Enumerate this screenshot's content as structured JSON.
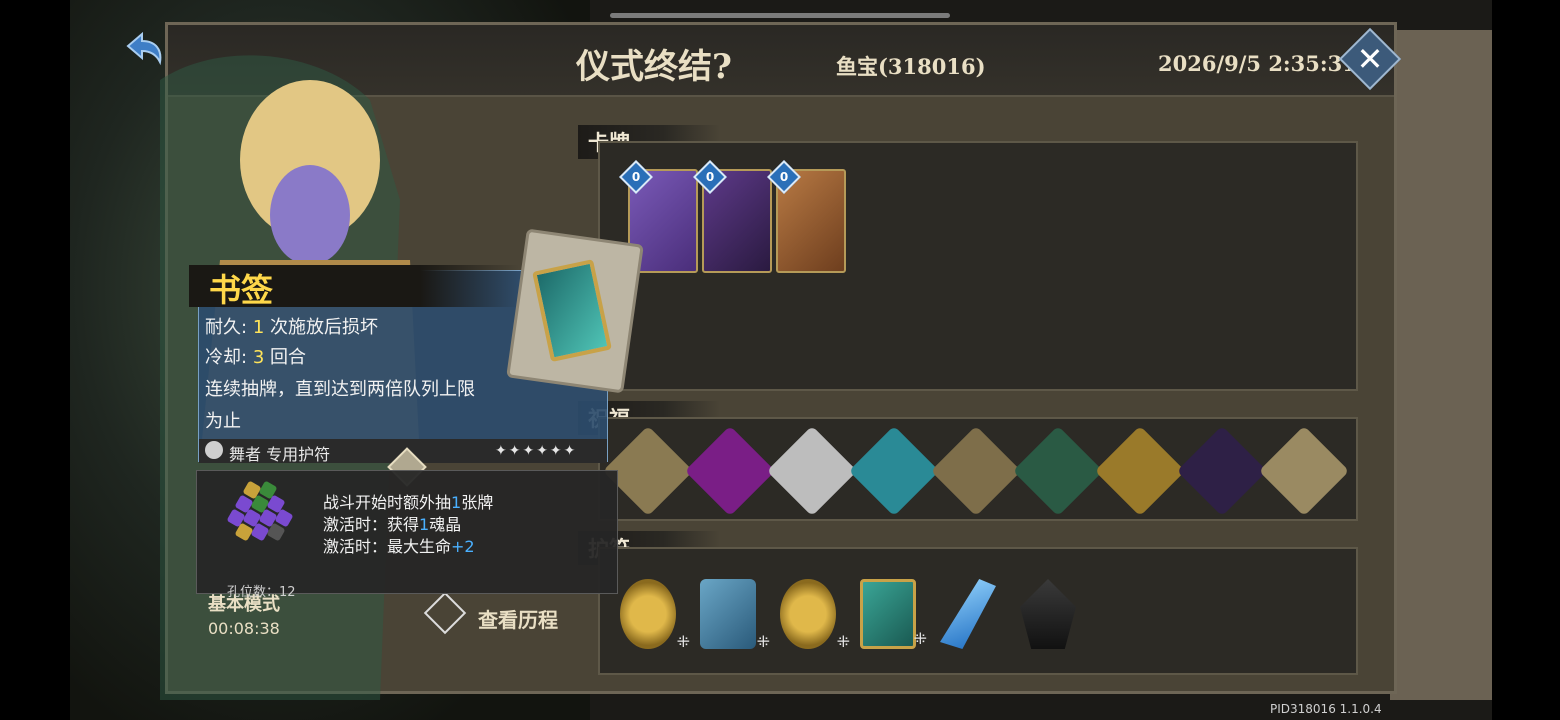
{
  "header": {
    "title": "仪式终结?",
    "player": "鱼宝(318016)",
    "datetime": "2026/9/5 2:35:31"
  },
  "sections": {
    "cards_label": "卡牌",
    "blessings_label": "祝福",
    "charms_label": "护符"
  },
  "cards": [
    {
      "cost": "0",
      "name": "playing-cards-card",
      "color": "#6b4aa0"
    },
    {
      "cost": "0",
      "name": "shadow-dancer-card",
      "color": "#4b2a6e"
    },
    {
      "cost": "0",
      "name": "dagger-card",
      "color": "#a0683a"
    }
  ],
  "blessings": [
    {
      "icon": "palm-leaf-icon",
      "color": "#d8c9a0"
    },
    {
      "icon": "purple-flame-icon",
      "color": "#b02ab8"
    },
    {
      "icon": "fencer-icon",
      "color": "#e0e0e0"
    },
    {
      "icon": "teal-crystal-icon",
      "color": "#4fc3c8"
    },
    {
      "icon": "card-pouch-icon",
      "color": "#b49c6a"
    },
    {
      "icon": "vip-emblem-icon",
      "color": "#3a7a56"
    },
    {
      "icon": "golden-spark-icon",
      "color": "#e0b84a"
    },
    {
      "icon": "dark-beast-icon",
      "color": "#3a2a5a"
    },
    {
      "icon": "blond-hero-portrait-icon",
      "color": "#c8b88a"
    }
  ],
  "charms": [
    {
      "icon": "gold-coin-charm-icon",
      "color": "#c9a23a"
    },
    {
      "icon": "blue-scroll-charm-icon",
      "color": "#4a7ea0"
    },
    {
      "icon": "gold-coin-charm-icon",
      "color": "#c9a23a"
    },
    {
      "icon": "bookmark-charm-icon",
      "color": "#2f8a7a"
    },
    {
      "icon": "ice-blade-charm-icon",
      "color": "#3aa6e0"
    },
    {
      "icon": "dark-cloak-charm-icon",
      "color": "#2a2a2a"
    }
  ],
  "tooltip": {
    "name": "书签",
    "durability_label": "耐久:",
    "durability_value": "1",
    "durability_suffix": "次施放后损坏",
    "cooldown_label": "冷却:",
    "cooldown_value": "3",
    "cooldown_suffix": "回合",
    "description_1": "连续抽牌，直到达到两倍队列上限",
    "description_2": "为止",
    "owner": "舞者 专用护符",
    "durability_marks": "✦✦✦✦✦✦"
  },
  "slots": {
    "effect_1_a": "战斗开始时额外抽",
    "effect_1_b": "1",
    "effect_1_c": "张牌",
    "effect_2_a": "激活时：获得",
    "effect_2_b": "1",
    "effect_2_c": "魂晶",
    "effect_3_a": "激活时：最大生命",
    "effect_3_b": "+2",
    "slot_count": "孔位数：12"
  },
  "left": {
    "mode": "基本模式",
    "timer": "00:08:38",
    "view_history": "查看历程"
  },
  "footer": {
    "pid": "PID318016  1.1.0.4"
  },
  "colors": {
    "highlight_yellow": "#ffe45a",
    "highlight_blue": "#4ab0ff",
    "panel": "#4a4436",
    "box": "#2c2a25"
  }
}
